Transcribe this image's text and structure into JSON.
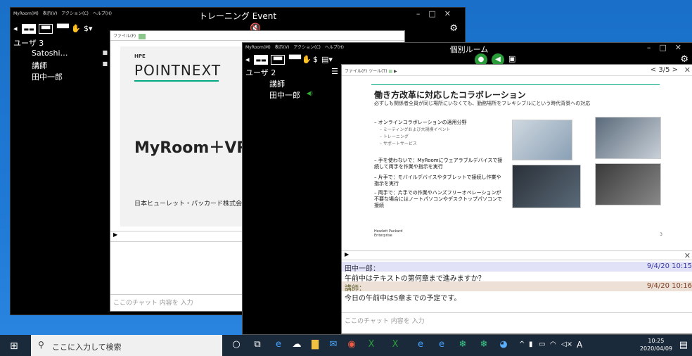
{
  "winA": {
    "menu": [
      "MyRoom(M)",
      "表示(V)",
      "アクション(C)",
      "ヘルプ(H)"
    ],
    "title": "トレーニング Event",
    "users_head": "ユーザ 3",
    "users": [
      "Satoshi…",
      "講師",
      "田中一郎"
    ],
    "file_menu": "ファイル(F)",
    "slide": {
      "hpe": "HPE",
      "pointnext": "POINTNEXT",
      "product": "MyRoom＋VRC",
      "company": "日本ヒューレット・パッカード株式会社"
    },
    "chat_placeholder": "ここのチャット 内容を 入力"
  },
  "winB": {
    "menu": [
      "MyRoom(M)",
      "表示(V)",
      "アクション(C)",
      "ヘルプ(H)"
    ],
    "title": "個別ルーム",
    "users_head": "ユーザ 2",
    "users": [
      "講師",
      "田中一郎"
    ],
    "file_menu": "ファイル(F)",
    "tool_menu": "ツール(T)",
    "pager": "3/5",
    "slide": {
      "title": "働き方改革に対応したコラボレーション",
      "subtitle": "必ずしも関係者全員が同じ場所にいなくても、勤務場所をフレキシブルにという時代背景への対応",
      "b1": "– オンラインコラボレーションの適用分野",
      "b1_subs": [
        "– ミーティングおよび大規模イベント",
        "– トレーニング",
        "– サポートサービス"
      ],
      "b2": "– 手を使わないで：MyRoomにウェアラブルデバイスで接続して両手を作業や指示を実行",
      "b3": "– 片手で：モバイルデバイスやタブレットで接続し作業や指示を実行",
      "b4": "– 両手で：片手での作業やハンズフリーオペレーションが不要な場合にはノートパソコンやデスクトップパソコンで接続",
      "logo": [
        "Hewlett Packard",
        "Enterprise"
      ],
      "page": "3"
    },
    "chat": [
      {
        "name": "田中一郎：",
        "time": "9/4/20 10:15",
        "msg": "午前中はテキストの第何章まで進みますか？"
      },
      {
        "name": "講師：",
        "time": "9/4/20 10:16",
        "msg": "今日の午前中は5章までの予定です。"
      }
    ],
    "chat_placeholder": "ここのチャット 内容を 入力"
  },
  "taskbar": {
    "search_placeholder": "ここに入力して検索",
    "time": "10:25",
    "date": "2020/04/09",
    "ime": "A"
  },
  "colors": {
    "green": "#2a9d3a",
    "accent": "#01a982",
    "taskbar": "#1b2a3a"
  }
}
